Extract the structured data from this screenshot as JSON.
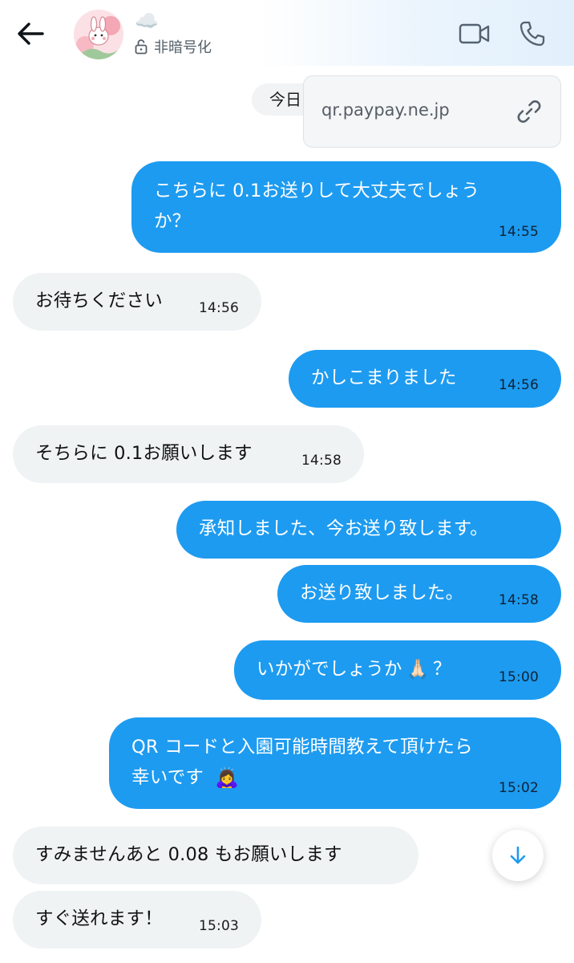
{
  "header": {
    "contact_name": "☁️",
    "encryption_label": "非暗号化"
  },
  "chat": {
    "date_label": "今日",
    "link_preview": {
      "url": "qr.paypay.ne.jp"
    },
    "messages": [
      {
        "dir": "out",
        "lines": [
          "こちらに 0.1お送りして大丈夫でしょう",
          "か？"
        ],
        "time": "14:55"
      },
      {
        "dir": "in",
        "lines": [
          "お待ちください"
        ],
        "time": "14:56"
      },
      {
        "dir": "out",
        "lines": [
          "かしこまりました"
        ],
        "time": "14:56"
      },
      {
        "dir": "in",
        "lines": [
          "そちらに 0.1お願いします"
        ],
        "time": "14:58"
      },
      {
        "dir": "out",
        "lines": [
          "承知しました、今お送り致します。"
        ],
        "time": ""
      },
      {
        "dir": "out",
        "lines": [
          "お送り致しました。"
        ],
        "time": "14:58"
      },
      {
        "dir": "out",
        "lines": [
          "いかがでしょうか",
          "🙏🏻",
          "？"
        ],
        "time": "15:00"
      },
      {
        "dir": "out",
        "lines": [
          "QR コードと入園可能時間教えて頂けたら",
          "幸いです",
          "🙇‍♀️"
        ],
        "time": "15:02"
      },
      {
        "dir": "in",
        "lines": [
          "すみませんあと 0.08 もお願いします"
        ],
        "time": ""
      },
      {
        "dir": "in",
        "lines": [
          "すぐ送れます！"
        ],
        "time": "15:03"
      }
    ]
  },
  "colors": {
    "outgoing": "#1d9bf0",
    "incoming": "#eff3f4",
    "accent": "#1d9bf0"
  },
  "icons": [
    "back-arrow-icon",
    "lock-icon",
    "video-call-icon",
    "phone-icon",
    "link-icon",
    "arrow-down-icon"
  ]
}
